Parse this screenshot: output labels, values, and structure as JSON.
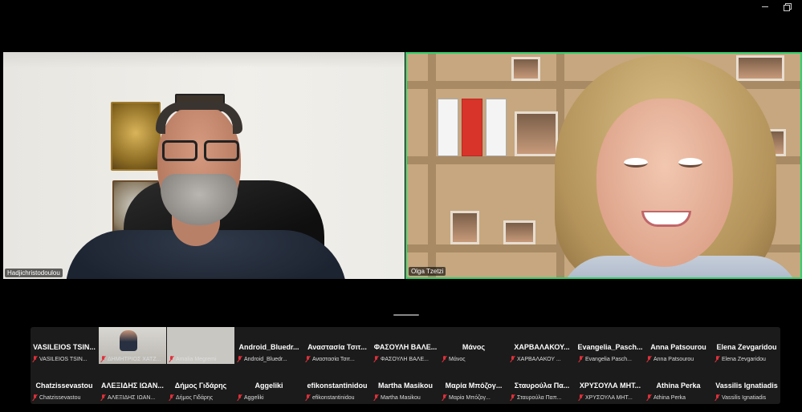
{
  "window": {
    "controls": [
      "minimize",
      "restore"
    ]
  },
  "main_videos": [
    {
      "name": "Hadjichristodoulou"
    },
    {
      "name": "Olga Tzetzi"
    }
  ],
  "gallery": {
    "row1": [
      {
        "name": "VASILEIOS TSIN...",
        "label": "VASILEIOS TSIN..."
      },
      {
        "name": "",
        "label": "ΔΗΜΗΤΡΙΟΣ ΧΑΤΖ..."
      },
      {
        "name": "",
        "label": "Amalia Megremi"
      },
      {
        "name": "Android_Bluedr...",
        "label": "Android_Bluedr..."
      },
      {
        "name": "Αναστασία Τσιτ...",
        "label": "Αναστασία Τσιτ..."
      },
      {
        "name": "ΦΑΣΟΥΛΗ ΒΑΛΕ...",
        "label": "ΦΑΣΟΥΛΗ ΒΑΛΕ..."
      },
      {
        "name": "Μάνος",
        "label": "Μάνος"
      },
      {
        "name": "ΧΑΡΒΑΛΑΚΟΥ...",
        "label": "ΧΑΡΒΑΛΑΚΟΥ ..."
      },
      {
        "name": "Evangelia_Pasch...",
        "label": "Evangelia Pasch..."
      },
      {
        "name": "Anna Patsourou",
        "label": "Anna Patsourou"
      },
      {
        "name": "Elena Zevgaridou",
        "label": "Elena Zevgaridou"
      }
    ],
    "row2": [
      {
        "name": "Chatzissevastou",
        "label": "Chatzissevastou"
      },
      {
        "name": "ΑΛΕΞΙΔΗΣ ΙΩΑΝ...",
        "label": "ΑΛΕΞΙΔΗΣ ΙΩΑΝ..."
      },
      {
        "name": "Δήμος Γιδάρης",
        "label": "Δήμος Γιδάρης"
      },
      {
        "name": "Aggeliki",
        "label": "Aggeliki"
      },
      {
        "name": "efikonstantinidou",
        "label": "efikonstantinidou"
      },
      {
        "name": "Martha Masikou",
        "label": "Martha Masikou"
      },
      {
        "name": "Μαρία Μπόζογ...",
        "label": "Μαρία Μπόζογ..."
      },
      {
        "name": "Σταυρούλα Πα...",
        "label": "Σταυρούλα Παπ..."
      },
      {
        "name": "ΧΡΥΣΟΥΛΑ ΜΗΤ...",
        "label": "ΧΡΥΣΟΥΛΑ ΜΗΤ..."
      },
      {
        "name": "Athina Perka",
        "label": "Athina Perka"
      },
      {
        "name": "Vassilis Ignatiadis",
        "label": "Vassilis Ignatiadis"
      }
    ]
  },
  "colors": {
    "active_speaker_border": "#2fd06a",
    "muted_icon": "#e0303a",
    "background": "#000000",
    "gallery_bg": "#1b1b1b"
  }
}
